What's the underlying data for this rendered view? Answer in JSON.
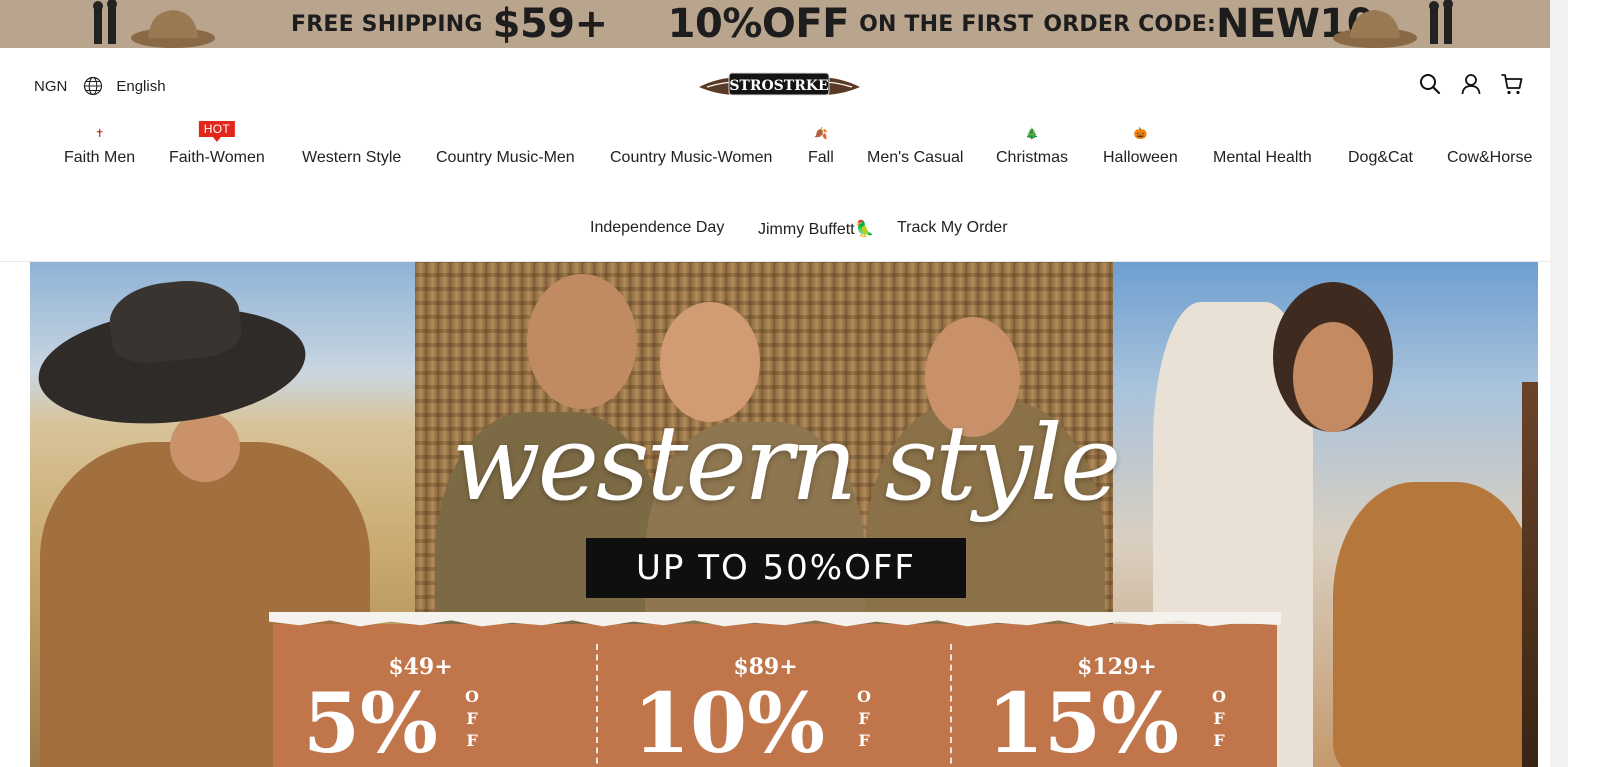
{
  "promo": {
    "free_shipping": "FREE SHIPPING",
    "threshold": "$59+",
    "discount": "10%OFF",
    "first_order": "ON THE FIRST",
    "code_label": "ORDER CODE:",
    "code": "NEW10"
  },
  "header": {
    "currency": "NGN",
    "language": "English",
    "logo_text": "STROSTRKE"
  },
  "nav": {
    "items": [
      {
        "label": "Faith Men",
        "mark": "✝"
      },
      {
        "label": "Faith-Women",
        "badge": "HOT"
      },
      {
        "label": "Western Style"
      },
      {
        "label": "Country Music-Men"
      },
      {
        "label": "Country Music-Women"
      },
      {
        "label": "Fall",
        "mark": "🍂"
      },
      {
        "label": "Men's Casual"
      },
      {
        "label": "Christmas",
        "mark": "🎄"
      },
      {
        "label": "Halloween",
        "mark": "🎃"
      },
      {
        "label": "Mental Health"
      },
      {
        "label": "Dog&Cat"
      },
      {
        "label": "Cow&Horse"
      },
      {
        "label": "Independence Day"
      },
      {
        "label": "Jimmy Buffett🦜"
      },
      {
        "label": "Track My Order"
      }
    ]
  },
  "hero": {
    "headline": "western style",
    "upto": "UP TO 50%OFF",
    "tiers": [
      {
        "threshold": "$49+",
        "percent": "5%",
        "off": "OFF"
      },
      {
        "threshold": "$89+",
        "percent": "10%",
        "off": "OFF"
      },
      {
        "threshold": "$129+",
        "percent": "15%",
        "off": "OFF"
      }
    ]
  },
  "colors": {
    "promo_bg": "#b9a58e",
    "hot_badge": "#e2271a",
    "tier_bg": "#c0764a"
  }
}
